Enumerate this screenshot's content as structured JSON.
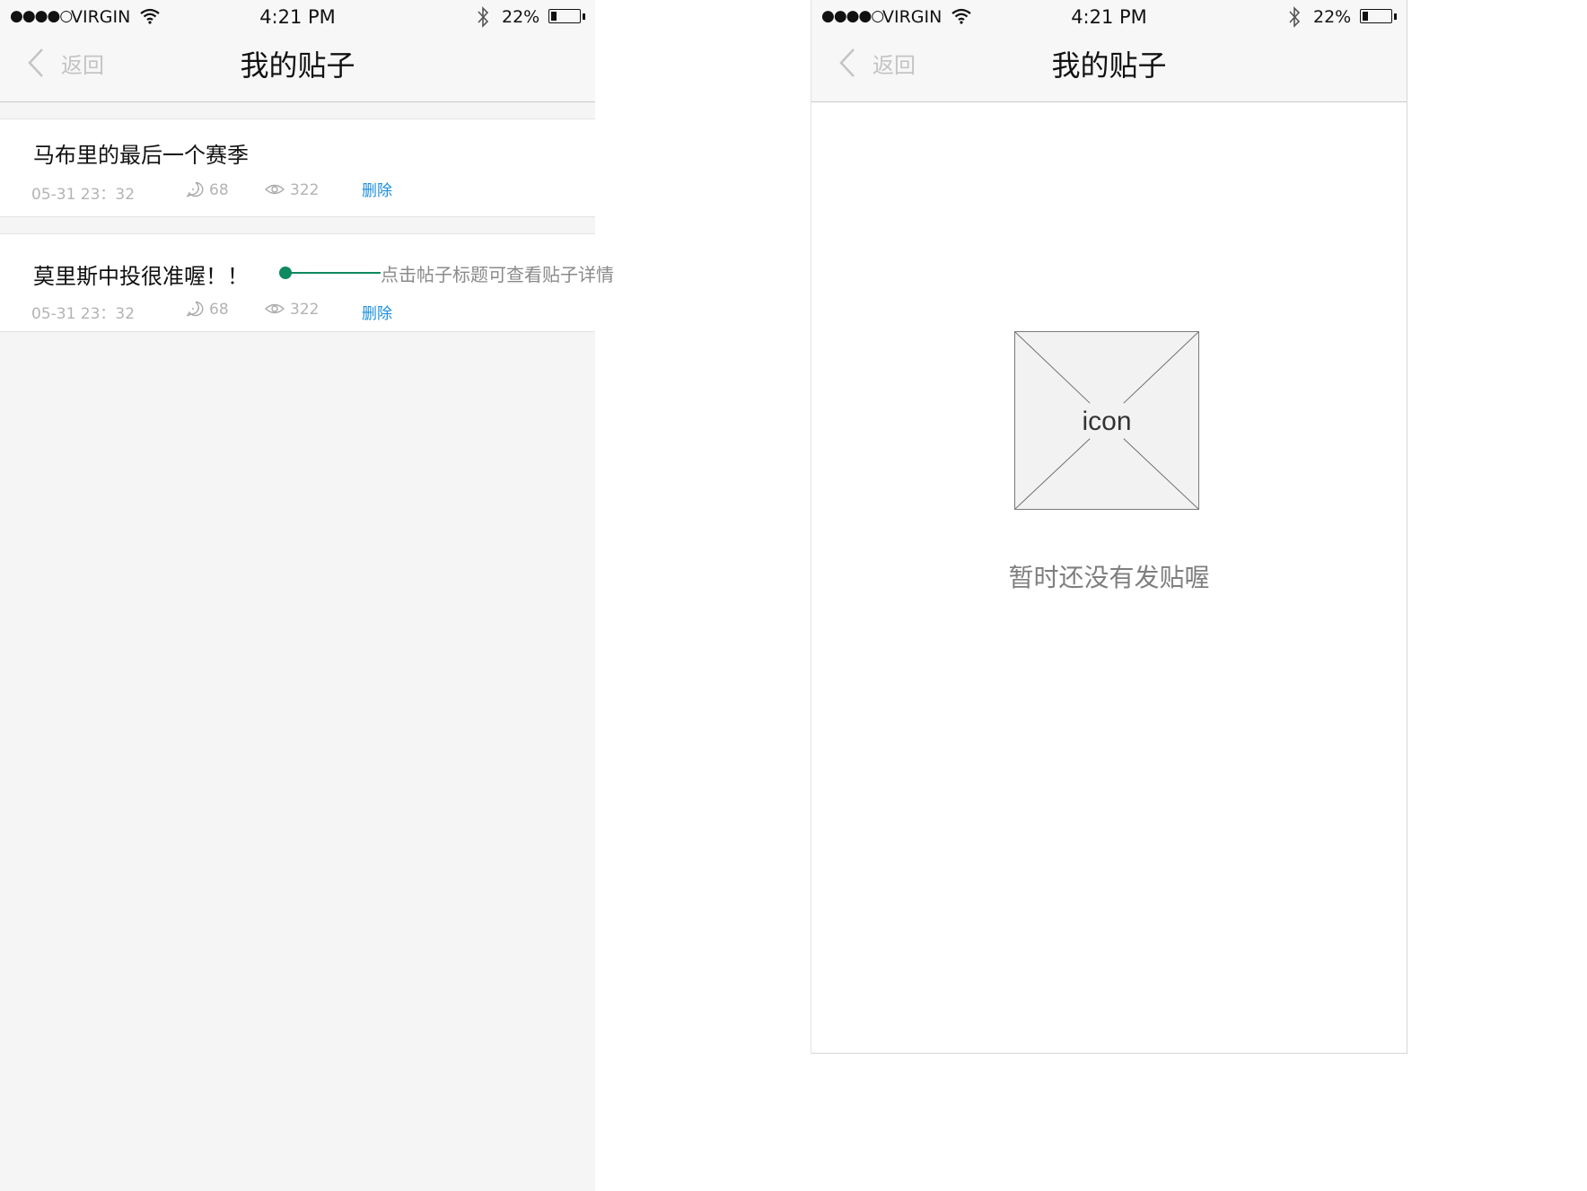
{
  "status_bar": {
    "signal": "●●●●○",
    "carrier": "VIRGIN",
    "time": "4:21 PM",
    "battery": "22%",
    "battery_level": 0.22
  },
  "nav": {
    "back_label": "返回",
    "title": "我的贴子"
  },
  "posts": [
    {
      "title": "马布里的最后一个赛季",
      "time": "05-31 23：32",
      "comments": "68",
      "views": "322",
      "delete_label": "删除"
    },
    {
      "title": "莫里斯中投很准喔！！",
      "time": "05-31 23：32",
      "comments": "68",
      "views": "322",
      "delete_label": "删除"
    }
  ],
  "annotation": {
    "text": "点击帖子标题可查看贴子详情"
  },
  "empty_state": {
    "icon_label": "icon",
    "message": "暂时还没有发贴喔"
  },
  "colors": {
    "accent_link": "#1a8fdd",
    "annotation": "#0d8a5e"
  }
}
